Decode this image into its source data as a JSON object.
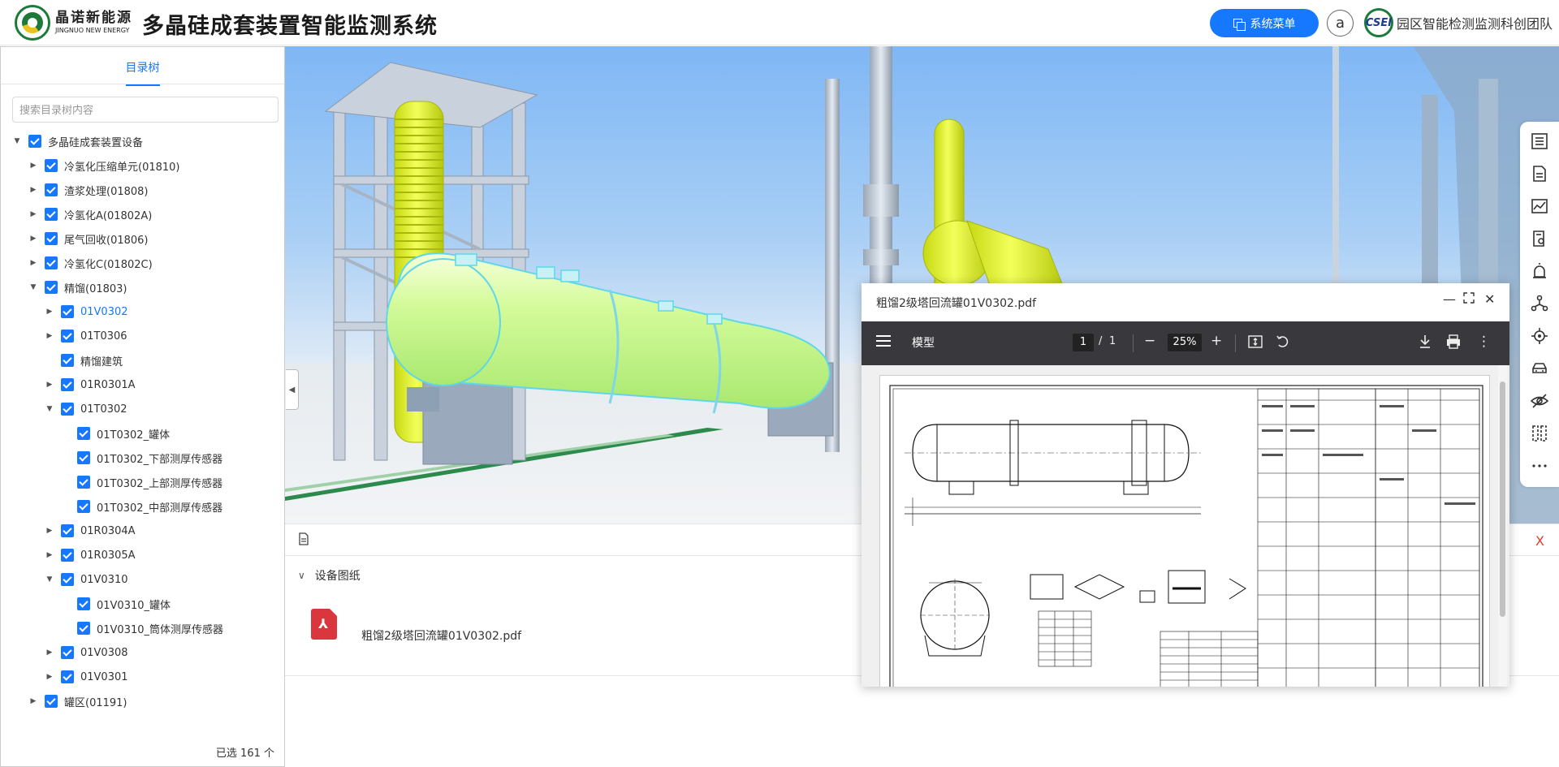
{
  "header": {
    "logo_cn": "晶诺新能源",
    "logo_en": "JINGNUO NEW ENERGY",
    "title": "多晶硅成套装置智能监测系统",
    "system_menu": "系统菜单",
    "avatar_letter": "a",
    "org_logo": "CSEI",
    "org_name": "园区智能检测监测科创团队"
  },
  "sidebar": {
    "tab": "目录树",
    "search_placeholder": "搜索目录树内容",
    "footer": "已选 161 个",
    "tree": [
      {
        "label": "多晶硅成套装置设备",
        "level": 0,
        "toggle": "open"
      },
      {
        "label": "冷氢化压缩单元(01810)",
        "level": 1,
        "toggle": "closed"
      },
      {
        "label": "渣浆处理(01808)",
        "level": 1,
        "toggle": "closed"
      },
      {
        "label": "冷氢化A(01802A)",
        "level": 1,
        "toggle": "closed"
      },
      {
        "label": "尾气回收(01806)",
        "level": 1,
        "toggle": "closed"
      },
      {
        "label": "冷氢化C(01802C)",
        "level": 1,
        "toggle": "closed"
      },
      {
        "label": "精馏(01803)",
        "level": 1,
        "toggle": "open"
      },
      {
        "label": "01V0302",
        "level": 2,
        "toggle": "closed",
        "selected": true
      },
      {
        "label": "01T0306",
        "level": 2,
        "toggle": "closed"
      },
      {
        "label": "精馏建筑",
        "level": 2,
        "toggle": "none"
      },
      {
        "label": "01R0301A",
        "level": 2,
        "toggle": "closed"
      },
      {
        "label": "01T0302",
        "level": 2,
        "toggle": "open"
      },
      {
        "label": "01T0302_罐体",
        "level": 3,
        "toggle": "none"
      },
      {
        "label": "01T0302_下部测厚传感器",
        "level": 3,
        "toggle": "none"
      },
      {
        "label": "01T0302_上部测厚传感器",
        "level": 3,
        "toggle": "none"
      },
      {
        "label": "01T0302_中部测厚传感器",
        "level": 3,
        "toggle": "none"
      },
      {
        "label": "01R0304A",
        "level": 2,
        "toggle": "closed"
      },
      {
        "label": "01R0305A",
        "level": 2,
        "toggle": "closed"
      },
      {
        "label": "01V0310",
        "level": 2,
        "toggle": "open"
      },
      {
        "label": "01V0310_罐体",
        "level": 3,
        "toggle": "none"
      },
      {
        "label": "01V0310_筒体测厚传感器",
        "level": 3,
        "toggle": "none"
      },
      {
        "label": "01V0308",
        "level": 2,
        "toggle": "closed"
      },
      {
        "label": "01V0301",
        "level": 2,
        "toggle": "closed"
      },
      {
        "label": "罐区(01191)",
        "level": 1,
        "toggle": "closed"
      }
    ]
  },
  "toolbar": {
    "icons": [
      "list-icon",
      "document-icon",
      "line-chart-icon",
      "report-icon",
      "alarm-icon",
      "network-icon",
      "locate-icon",
      "vehicle-icon",
      "hide-icon",
      "ruler-icon",
      "more-icon"
    ]
  },
  "info_panel": {
    "section_label": "设备图纸",
    "file_name": "粗馏2级塔回流罐01V0302.pdf",
    "close_glyph": "X"
  },
  "pdf_viewer": {
    "window_title": "粗馏2级塔回流罐01V0302.pdf",
    "doc_title": "模型",
    "page_current": "1",
    "page_sep": "/",
    "page_total": "1",
    "zoom": "25%"
  },
  "colors": {
    "accent": "#1677ff",
    "close_red": "#e23b2e",
    "pdf_toolbar": "#38383d",
    "vessel_green": "#c8f58a"
  }
}
